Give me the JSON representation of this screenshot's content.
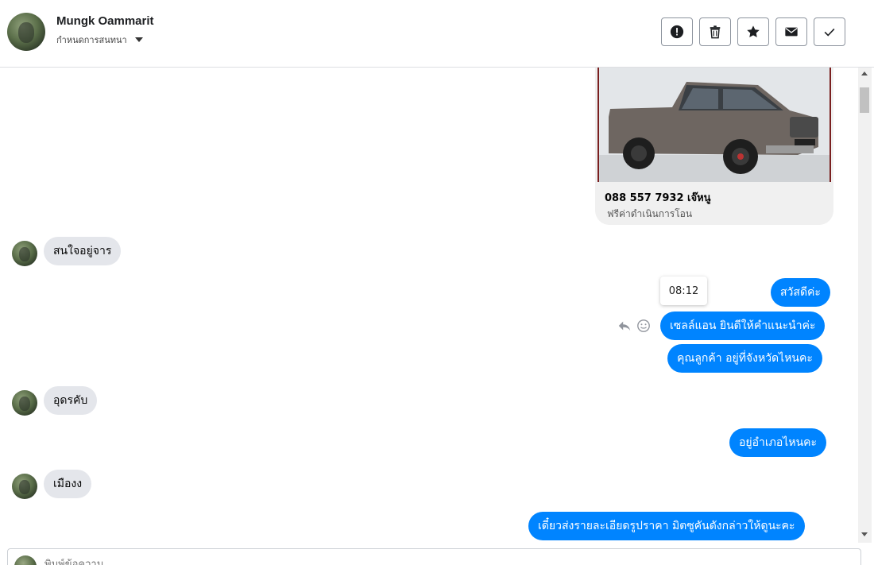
{
  "header": {
    "contact_name": "Mungk Oammarit",
    "subtitle": "กำหนดการสนทนา",
    "actions": [
      {
        "name": "report",
        "icon": "alert-icon"
      },
      {
        "name": "delete",
        "icon": "trash-icon"
      },
      {
        "name": "star",
        "icon": "star-icon"
      },
      {
        "name": "mail",
        "icon": "envelope-icon"
      },
      {
        "name": "done",
        "icon": "check-icon"
      }
    ]
  },
  "card": {
    "title": "088 557 7932 เจ๊หนู",
    "subtitle": "ฟรีค่าดำเนินการโอน"
  },
  "messages": [
    {
      "dir": "in",
      "text": "สนใจอยู่จาร"
    },
    {
      "dir": "out",
      "text": "สวัสดีค่ะ"
    },
    {
      "dir": "out",
      "text": "เซลล์แอน ยินดีให้คำแนะนำค่ะ"
    },
    {
      "dir": "out",
      "text": "คุณลูกค้า อยู่ที่จังหวัดไหนคะ"
    },
    {
      "dir": "in",
      "text": "อุดรคับ"
    },
    {
      "dir": "out",
      "text": "อยู่อำเภอไหนคะ"
    },
    {
      "dir": "in",
      "text": "เมืองง"
    },
    {
      "dir": "out",
      "text": "เดี๋ยวส่งรายละเอียดรูปราคา มิตซูคันดังกล่าวให้ดูนะคะ"
    }
  ],
  "tooltip": {
    "time": "08:12"
  },
  "composer": {
    "placeholder": "พิมพ์ข้อความ..."
  },
  "colors": {
    "outgoing": "#0084ff",
    "incoming": "#e4e6eb"
  }
}
